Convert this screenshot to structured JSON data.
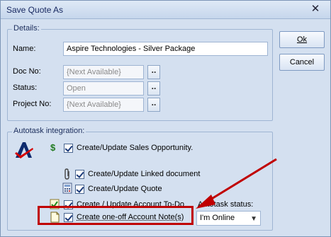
{
  "window": {
    "title": "Save Quote As",
    "close_glyph": "✕"
  },
  "details": {
    "legend": "Details:",
    "name_label": "Name:",
    "name_value": "Aspire Technologies - Silver Package",
    "doc_label": "Doc No:",
    "doc_value": "{Next Available}",
    "status_label": "Status:",
    "status_value": "Open",
    "project_label": "Project No:",
    "project_value": "{Next Available}",
    "browse_label": ".."
  },
  "buttons": {
    "ok_label": "Ok",
    "cancel_label": "Cancel"
  },
  "integration": {
    "legend": "Autotask integration:",
    "items": [
      {
        "label": "Create/Update Sales Opportunity.",
        "checked": true,
        "icon": "dollar-icon"
      },
      {
        "label": "Create/Update Linked document",
        "checked": true,
        "icon": "paperclip-icon"
      },
      {
        "label": "Create/Update Quote",
        "checked": true,
        "icon": "calculator-icon"
      },
      {
        "label": "Create / Update Account To-Do",
        "checked": true,
        "icon": "todo-check-icon"
      },
      {
        "label": "Create one-off Account Note(s)",
        "checked": true,
        "icon": "note-icon"
      }
    ],
    "status_label": "Autotask status:",
    "status_value": "I'm Online"
  },
  "colors": {
    "accent": "#c00000",
    "dialog_bg": "#d4e0f0"
  }
}
